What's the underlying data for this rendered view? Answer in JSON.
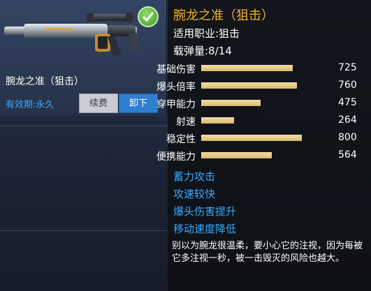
{
  "weapon": {
    "name": "腕龙之准（狙击）",
    "validity": "有效期:永久",
    "renew_label": "续费",
    "unequip_label": "卸下",
    "equipped_icon": "check-icon"
  },
  "tooltip": {
    "title": "腕龙之准（狙击）",
    "profession": "适用职业:狙击",
    "ammo": "载弹量:8/14",
    "stats": [
      {
        "label": "基础伤害",
        "value": "725",
        "level": 0.73
      },
      {
        "label": "爆头倍率",
        "value": "760",
        "level": 0.76
      },
      {
        "label": "穿甲能力",
        "value": "475",
        "level": 0.47
      },
      {
        "label": "射速",
        "value": "264",
        "level": 0.26
      },
      {
        "label": "稳定性",
        "value": "800",
        "level": 0.8
      },
      {
        "label": "便携能力",
        "value": "564",
        "level": 0.56
      }
    ],
    "features": [
      "蓄力攻击",
      "攻速较快",
      "爆头伤害提升",
      "移动速度降低"
    ],
    "description": "别以为腕龙很温柔，要小心它的注视，因为每被它多注视一秒，被一击毁灭的风险也越大。"
  },
  "colors": {
    "title": "#f2b01e",
    "feature": "#3aa8ff",
    "bar": "#d9b96d",
    "unequip": "#2f7fd0"
  }
}
